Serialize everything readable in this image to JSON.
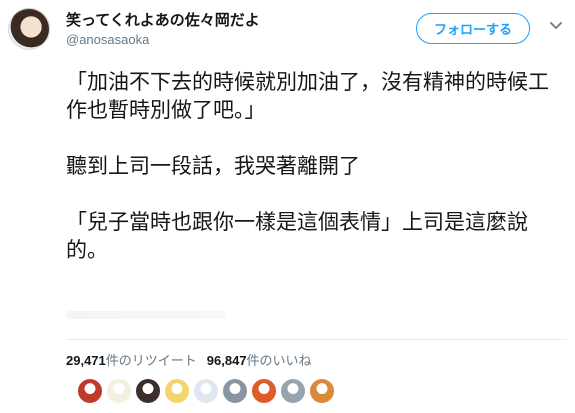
{
  "user": {
    "display_name": "笑ってくれよあの佐々岡だよ",
    "handle": "@anosasaoka",
    "follow_label": "フォローする"
  },
  "tweet": {
    "paragraphs": [
      "「加油不下去的時候就別加油了，沒有精神的時候工作也暫時別做了吧。」",
      "聽到上司一段話，我哭著離開了",
      "「兒子當時也跟你一樣是這個表情」上司是這麼說的。"
    ]
  },
  "stats": {
    "retweets_count": "29,471",
    "retweets_label": "件のリツイート",
    "likes_count": "96,847",
    "likes_label": "件のいいね"
  },
  "likers": {
    "colors": [
      "#c0392b",
      "#f5efe0",
      "#3b2f2a",
      "#f2d66b",
      "#dfe7f2",
      "#8a95a3",
      "#e05a2a",
      "#98a3b0",
      "#d98a3a"
    ]
  },
  "colors": {
    "accent": "#1da1f2",
    "text": "#14171a",
    "muted": "#657786"
  },
  "icons": {
    "menu": "chevron-down-icon"
  }
}
